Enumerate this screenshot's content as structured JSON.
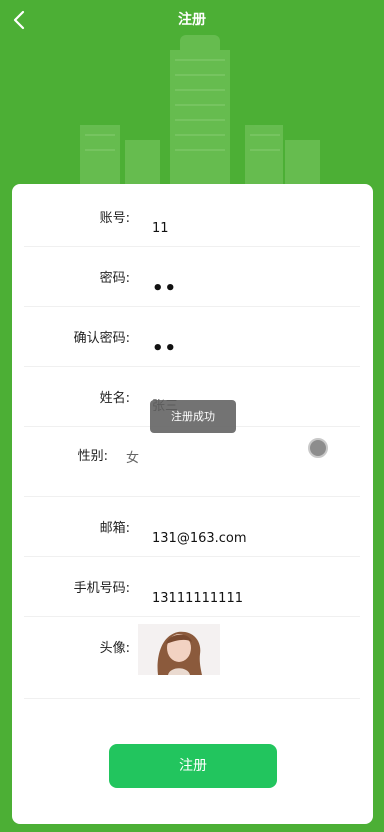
{
  "header": {
    "title": "注册",
    "back_icon": "chevron-left-icon"
  },
  "form": {
    "account": {
      "label": "账号:",
      "value": "11"
    },
    "password": {
      "label": "密码:",
      "value": "••"
    },
    "confirm_password": {
      "label": "确认密码:",
      "value": "••"
    },
    "name": {
      "label": "姓名:",
      "value": "张三"
    },
    "gender": {
      "label": "性别:",
      "value": "女"
    },
    "email": {
      "label": "邮箱:",
      "value": "131@163.com"
    },
    "phone": {
      "label": "手机号码:",
      "value": "13111111111"
    },
    "avatar": {
      "label": "头像:"
    }
  },
  "submit": {
    "label": "注册"
  },
  "toast": {
    "text": "注册成功"
  },
  "colors": {
    "background": "#4caf35",
    "button": "#22c55e"
  }
}
